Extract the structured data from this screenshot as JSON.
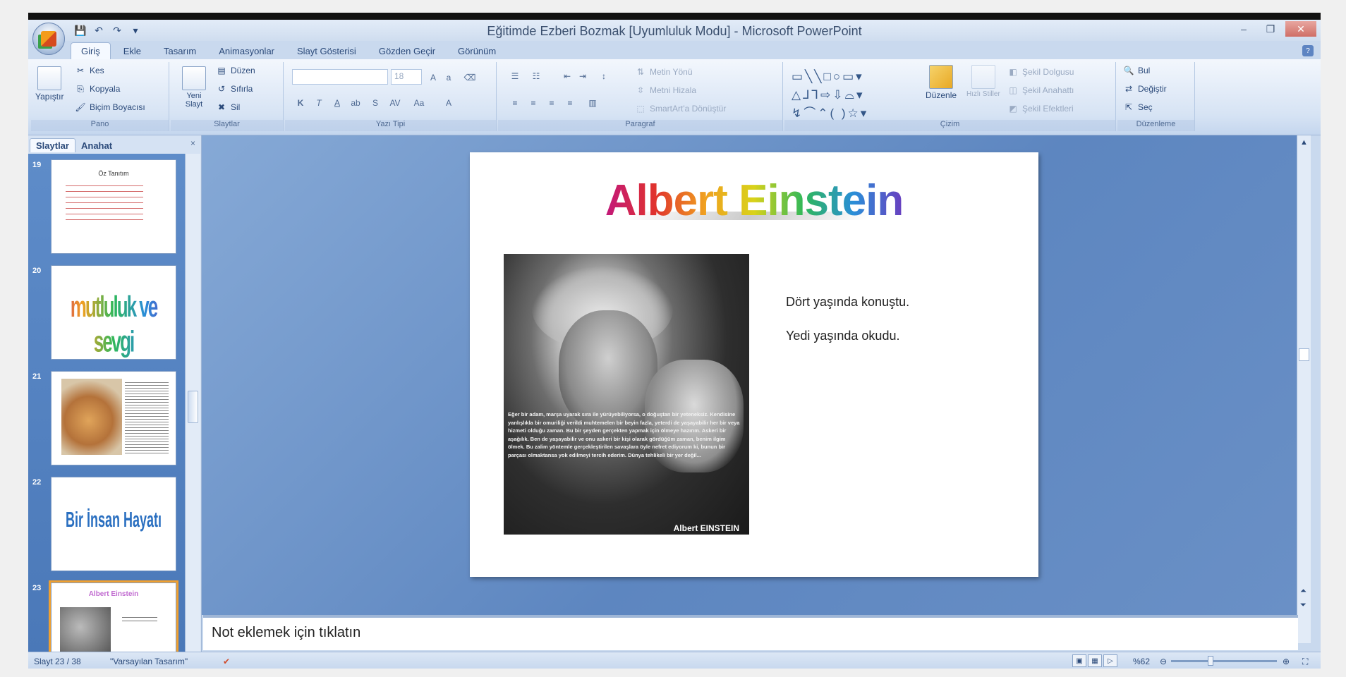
{
  "window": {
    "title": "Eğitimde Ezberi Bozmak [Uyumluluk Modu] - Microsoft PowerPoint",
    "minimize": "–",
    "restore": "❐",
    "close": "✕"
  },
  "qat": {
    "save": "💾",
    "undo": "↶",
    "redo": "↷",
    "customize": "▾"
  },
  "tabs": [
    "Giriş",
    "Ekle",
    "Tasarım",
    "Animasyonlar",
    "Slayt Gösterisi",
    "Gözden Geçir",
    "Görünüm"
  ],
  "ribbon": {
    "pano": {
      "paste": "Yapıştır",
      "cut": "Kes",
      "copy": "Kopyala",
      "format_painter": "Biçim Boyacısı",
      "label": "Pano"
    },
    "slaytlar": {
      "new_slide": "Yeni Slayt",
      "layout": "Düzen",
      "reset": "Sıfırla",
      "delete": "Sil",
      "label": "Slaytlar"
    },
    "yazi_tipi": {
      "font_size": "18",
      "bold": "K",
      "italic": "T",
      "underline": "A",
      "label": "Yazı Tipi"
    },
    "paragraf": {
      "text_direction": "Metin Yönü",
      "align_text": "Metni Hizala",
      "smartart": "SmartArt'a Dönüştür",
      "label": "Paragraf"
    },
    "cizim": {
      "arrange": "Düzenle",
      "quick_styles": "Hızlı Stiller",
      "shape_fill": "Şekil Dolgusu",
      "shape_outline": "Şekil Anahattı",
      "shape_effects": "Şekil Efektleri",
      "label": "Çizim"
    },
    "duzenleme": {
      "find": "Bul",
      "replace": "Değiştir",
      "select": "Seç",
      "label": "Düzenleme"
    }
  },
  "panel": {
    "tabs": [
      "Slaytlar",
      "Anahat"
    ],
    "close": "×",
    "thumbnails": [
      {
        "num": "19",
        "title": "Öz Tanıtım"
      },
      {
        "num": "20",
        "title": "mutluluk ve sevgi"
      },
      {
        "num": "21",
        "title": ""
      },
      {
        "num": "22",
        "title": "Bir İnsan Hayatı"
      },
      {
        "num": "23",
        "title": "Albert Einstein"
      }
    ]
  },
  "slide": {
    "title": "Albert Einstein",
    "bullets": [
      "Dört yaşında  konuştu.",
      "Yedi yaşında  okudu."
    ],
    "photo_quote": "Eğer bir adam, marşa uyarak sıra ile yürüyebiliyorsa, o doğuştan bir yeteneksiz. Kendisine yanlışlıkla bir omuriliği verildi muhtemelen bir beyin fazla, yeterdi de yaşayabilir her bir veya hizmeti olduğu zaman. Bu bir şeyden gerçekten yapmak için ölmeye hazırım. Askeri bir aşağılık. Ben de yaşayabilir ve onu askeri bir kişi olarak gördüğüm zaman, benim ilgim ölmek. Bu zalim yöntemle gerçekleştirilen savaşlara öyle nefret ediyorum ki, bunun bir parçası olmaktansa yok edilmeyi tercih ederim. Dünya tehlikeli bir yer değil...",
    "photo_signature": "Albert EINSTEIN"
  },
  "notes": {
    "placeholder": "Not eklemek için tıklatın"
  },
  "status": {
    "slide": "Slayt 23 / 38",
    "theme": "\"Varsayılan Tasarım\"",
    "zoom": "%62"
  }
}
